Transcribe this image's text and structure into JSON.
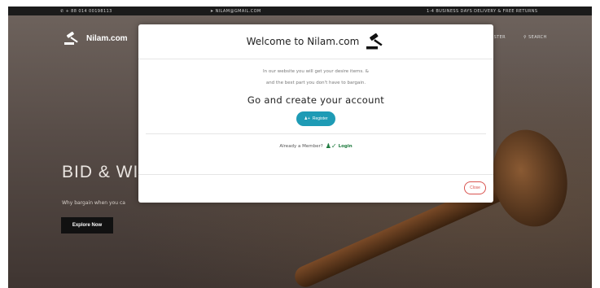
{
  "topbar": {
    "phone": "+ 88 014 00198113",
    "email": "NILAM@GMAIL.COM",
    "delivery": "1-4 BUSINESS DAYS DELIVERY & FREE RETURNS"
  },
  "header": {
    "brand": "Nilam.com",
    "register_link": "REGISTER",
    "search_link": "SEARCH"
  },
  "hero": {
    "title": "BID & WI",
    "subtitle": "Why bargain when you ca",
    "cta": "Explore Now"
  },
  "modal": {
    "title": "Welcome to Nilam.com",
    "line1": "In our website you will get your desire items. &",
    "line2": "and the best part you don't have to bargain.",
    "heading": "Go and create your account",
    "register_button": "Register",
    "member_text": "Already a Member?",
    "login_link": "Login",
    "close_button": "Close"
  },
  "colors": {
    "register": "#1e9bb5",
    "login": "#1d7a3d",
    "close": "#d9534f"
  }
}
